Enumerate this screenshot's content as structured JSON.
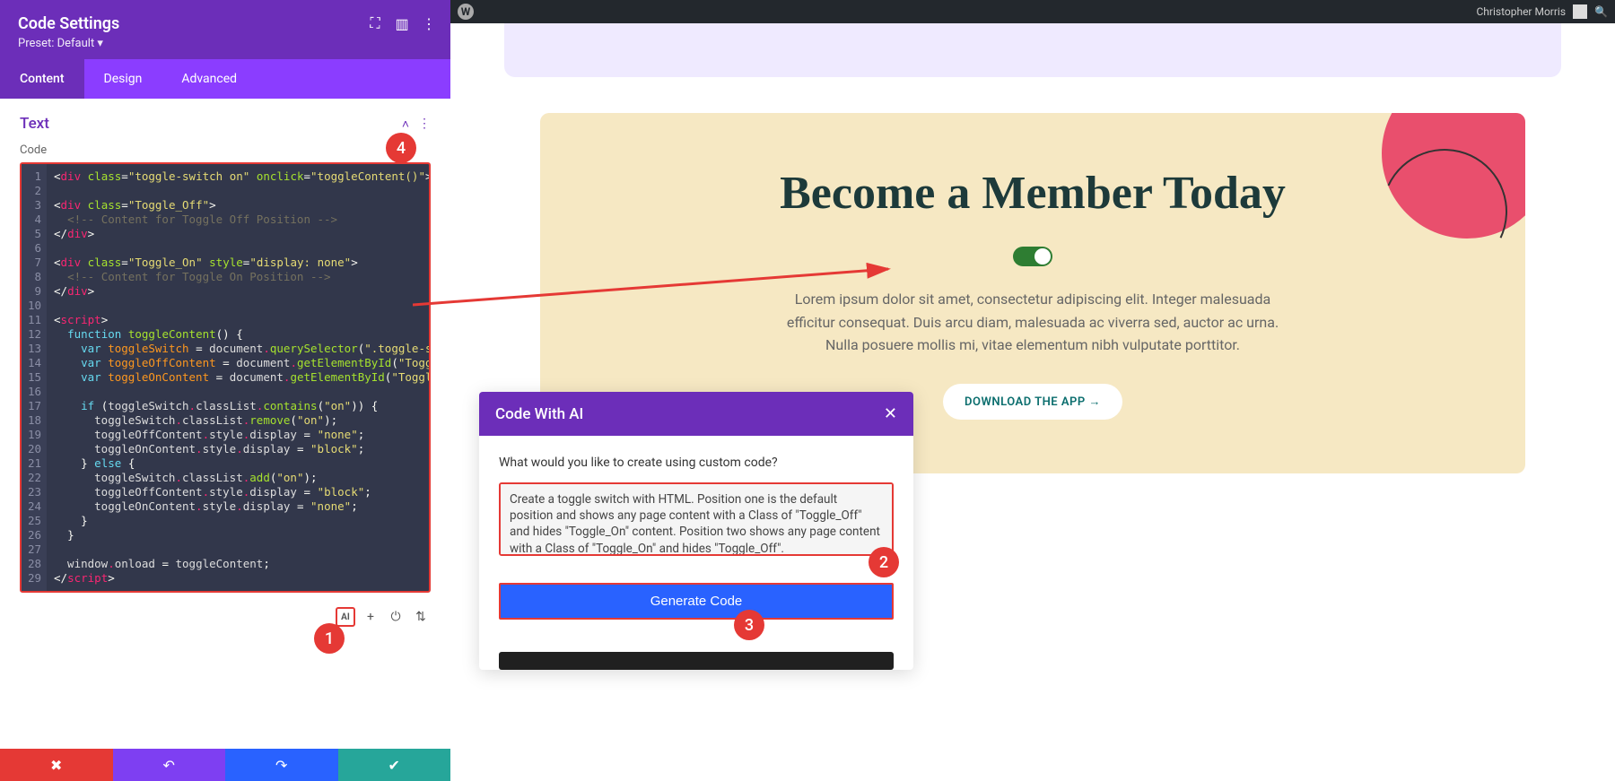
{
  "panel": {
    "title": "Code Settings",
    "preset": "Preset: Default ▾",
    "tabs": {
      "content": "Content",
      "design": "Design",
      "advanced": "Advanced"
    },
    "section_title": "Text",
    "code_label": "Code",
    "editor_tools": {
      "ai": "AI",
      "plus": "+",
      "power": "⏻",
      "sort": "⇅"
    },
    "code_lines": 29
  },
  "admin": {
    "user": "Christopher Morris"
  },
  "hero": {
    "title": "Become a Member Today",
    "desc": "Lorem ipsum dolor sit amet, consectetur adipiscing elit. Integer malesuada efficitur consequat. Duis arcu diam, malesuada ac viverra sed, auctor ac urna. Nulla posuere mollis mi, vitae elementum nibh vulputate porttitor.",
    "cta": "DOWNLOAD THE APP →"
  },
  "ai_dialog": {
    "title": "Code With AI",
    "prompt_label": "What would you like to create using custom code?",
    "prompt_value": "Create a toggle switch with HTML. Position one is the default position and shows any page content with a Class of \"Toggle_Off\" and hides \"Toggle_On\" content. Position two shows any page content with a Class of \"Toggle_On\" and hides \"Toggle_Off\".",
    "generate": "Generate Code"
  },
  "markers": {
    "m1": "1",
    "m2": "2",
    "m3": "3",
    "m4": "4"
  },
  "colors": {
    "accent": "#6c2eb9",
    "highlight": "#e53935"
  }
}
